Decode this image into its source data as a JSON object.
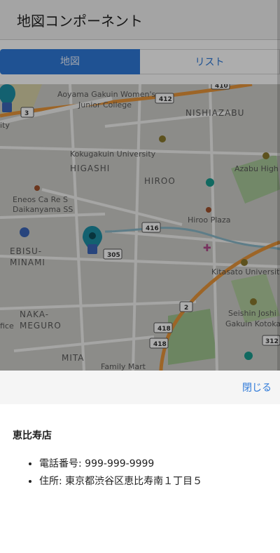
{
  "appbar": {
    "title": "地図コンポーネント"
  },
  "tabs": [
    {
      "label": "地図",
      "active": true
    },
    {
      "label": "リスト",
      "active": false
    }
  ],
  "map": {
    "labels": {
      "aoyama": "Aoyama Gakuin Women's",
      "aoyama2": "Junior College",
      "nishiazabu": "NISHIAZABU",
      "kokugakuin": "Kokugakuin University",
      "higashi": "HIGASHI",
      "hiroo": "HIROO",
      "azabu": "Azabu High S",
      "eneos": "Eneos Ca Re S",
      "daikanyama": "Daikanyama SS",
      "hirooPlaza": "Hiroo Plaza",
      "ebisu": "EBISU-",
      "minami": "MINAMI",
      "kitasato": "Kitasato University",
      "seishin": "Seishin Joshi",
      "gakuin": "Gakuin Kotoka",
      "naka": "NAKA-",
      "meguro": "MEGURO",
      "mita": "MITA",
      "familyMart": "Family Mart",
      "office": "fice",
      "city": "ity"
    },
    "shields": [
      "412",
      "410",
      "3",
      "416",
      "305",
      "2",
      "418",
      "418",
      "312"
    ]
  },
  "sheet": {
    "close_label": "閉じる"
  },
  "store": {
    "name": "恵比寿店",
    "phone": "電話番号: 999-999-9999",
    "address": "住所: 東京都渋谷区恵比寿南１丁目５"
  },
  "colors": {
    "accent": "#2f7ad9",
    "marker": "#1d8fa6",
    "arterial": "#e8953a"
  }
}
